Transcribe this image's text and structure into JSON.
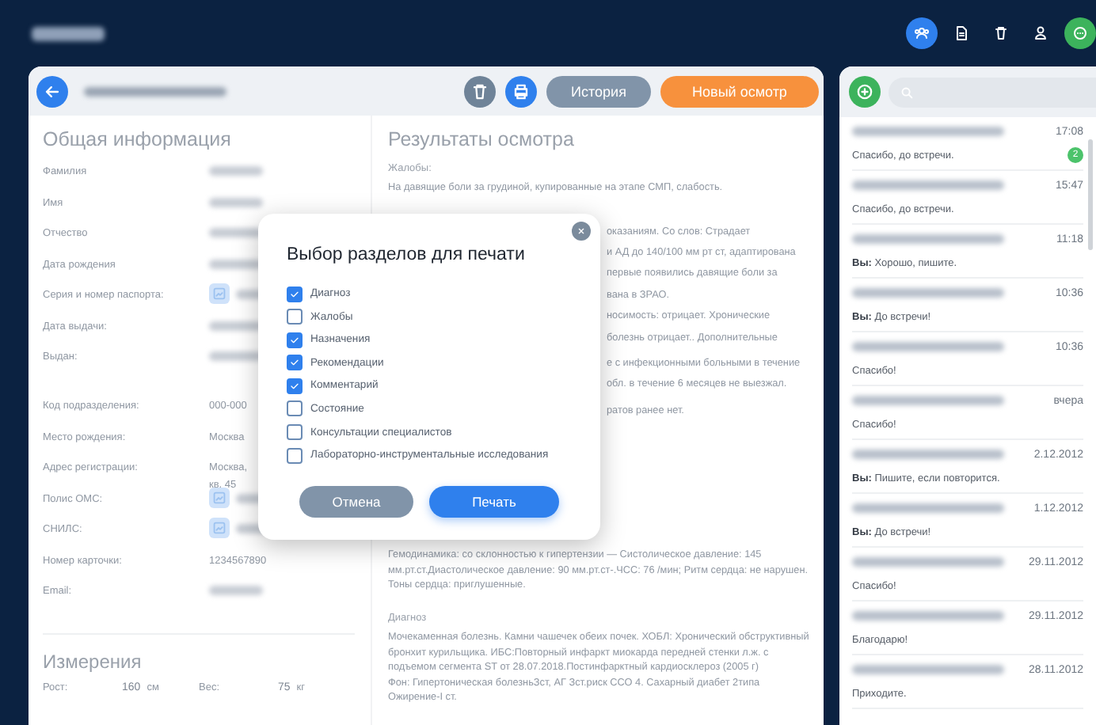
{
  "top_bar": {
    "nav": [
      {
        "selected": true
      },
      {
        "selected": false
      },
      {
        "selected": false
      },
      {
        "selected": false
      },
      {
        "selected": false
      }
    ]
  },
  "patient_header": {
    "buttons": [
      {
        "kind": "delete"
      },
      {
        "kind": "print"
      },
      {
        "kind": "secondary",
        "label": "История"
      },
      {
        "kind": "primary",
        "label": "Новый осмотр"
      }
    ]
  },
  "general_info": {
    "title": "Общая информация",
    "fields": [
      {
        "kind": "hidden",
        "label": "Фамилия"
      },
      {
        "kind": "hidden",
        "label": "Имя"
      },
      {
        "kind": "hidden",
        "label": "Отчество"
      },
      {
        "kind": "hidden",
        "label": "Дата рождения"
      },
      {
        "kind": "document",
        "label": "Серия и номер паспорта:"
      },
      {
        "kind": "hidden",
        "label": "Дата выдачи:"
      },
      {
        "kind": "hidden_multiline",
        "label": "Выдан:"
      },
      {
        "kind": "text",
        "label": "Код подразделения:",
        "value": "000-000"
      },
      {
        "kind": "text",
        "label": "Место рождения:",
        "value": "Москва"
      },
      {
        "kind": "text",
        "label": "Адрес регистрации:",
        "value": "Москва,",
        "value_2": "кв. 45"
      },
      {
        "kind": "document",
        "label": "Полис ОМС:"
      },
      {
        "kind": "document",
        "label": "СНИЛС:"
      },
      {
        "kind": "text",
        "label": "Номер карточки:",
        "value": "1234567890"
      },
      {
        "kind": "hidden",
        "label": "Email:"
      }
    ]
  },
  "measurements": {
    "title": "Измерения",
    "items": [
      {
        "label": "Рост:",
        "value": "160",
        "unit": "см"
      },
      {
        "label": "Вес:",
        "value": "75",
        "unit": "кг"
      }
    ]
  },
  "results": {
    "title": "Результаты осмотра",
    "sections": [
      {
        "kind": "section",
        "label": "Жалобы:",
        "text": "На давящие боли за грудиной, купированные на этапе СМП, слабость."
      },
      {
        "kind": "fragments",
        "lines": [
          "оказаниям. Со слов: Страдает",
          "и АД до 140/100 мм рт ст, адаптирована",
          "первые появились давящие боли за",
          "вана в ЗРАО.",
          "носимость: отрицает. Хронические",
          "болезнь отрицает.. Дополнительные",
          "е с инфекционными больными в течение",
          "обл. в течение 6 месяцев не выезжал.",
          "ратов ранее нет."
        ]
      },
      {
        "kind": "section",
        "text": "Гемодинамика: со склонностью к гипертензии — Систолическое давление: 145 мм.рт.ст.Диастолическое давление: 90 мм.рт.ст-.ЧСС: 76 /мин; Ритм сердца: не нарушен. Тоны сердца: приглушенные."
      },
      {
        "kind": "section",
        "label": "Диагноз",
        "text": "Мочекаменная болезнь. Камни чашечек обеих почек. ХОБЛ: Хронический обструктивный бронхит курильщика. ИБС:Повторный инфаркт миокарда передней стенки л.ж. с подъемом сегмента ST от 28.07.2018.Постинфарктный кардиосклероз (2005 г)",
        "text_2": "Фон: Гипертоническая болезньЗст, АГ Зст.риск ССО 4. Сахарный диабет 2типа Ожирение-I ст."
      }
    ]
  },
  "chats": {
    "items": [
      {
        "time": "17:08",
        "preview": "Спасибо, до встречи.",
        "unread": "2"
      },
      {
        "time": "15:47",
        "preview": "Спасибо, до встречи."
      },
      {
        "time": "11:18",
        "preview": "**Вы:** Хорошо, пишите."
      },
      {
        "time": "10:36",
        "preview": "**Вы:** До встречи!"
      },
      {
        "time": "10:36",
        "preview": "Спасибо!"
      },
      {
        "time": "вчера",
        "preview": "Спасибо!"
      },
      {
        "time": "2.12.2012",
        "preview": "**Вы:** Пишите, если повторится."
      },
      {
        "time": "1.12.2012",
        "preview": "**Вы:** До встречи!"
      },
      {
        "time": "29.11.2012",
        "preview": "Спасибо!"
      },
      {
        "time": "29.11.2012",
        "preview": "Благодарю!"
      },
      {
        "time": "28.11.2012",
        "preview": "Приходите."
      }
    ]
  },
  "print_dialog": {
    "title": "Выбор разделов для печати",
    "options": [
      {
        "label": "Диагноз",
        "checked": true
      },
      {
        "label": "Жалобы",
        "checked": false
      },
      {
        "label": "Назначения",
        "checked": true
      },
      {
        "label": "Рекомендации",
        "checked": true
      },
      {
        "label": "Комментарий",
        "checked": true
      },
      {
        "label": "Состояние",
        "checked": false
      },
      {
        "label": "Консультации специалистов",
        "checked": false
      },
      {
        "label": "Лабораторно-инструментальные исследования",
        "checked": false
      }
    ],
    "buttons": [
      {
        "kind": "cancel",
        "label": "Отмена"
      },
      {
        "kind": "confirm",
        "label": "Печать"
      }
    ]
  }
}
